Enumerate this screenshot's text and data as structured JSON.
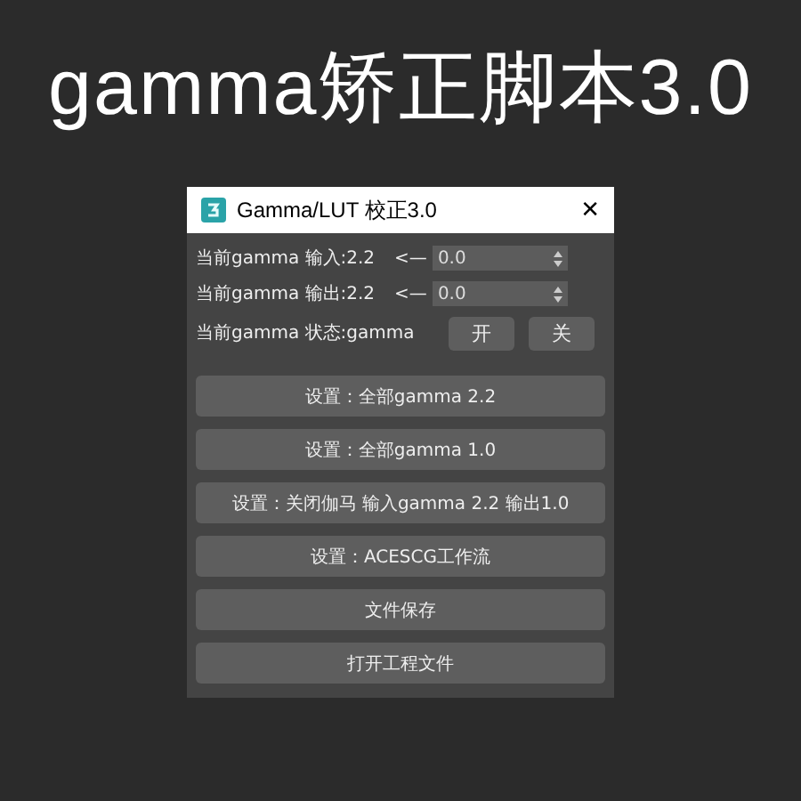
{
  "heading": "gamma矫正脚本3.0",
  "window": {
    "title": "Gamma/LUT 校正3.0",
    "close": "✕"
  },
  "rows": [
    {
      "kind": "spinner",
      "label": "当前gamma 输入:2.2",
      "arrow": "<—",
      "value": "0.0"
    },
    {
      "kind": "spinner",
      "label": "当前gamma 输出:2.2",
      "arrow": "<—",
      "value": "0.0"
    },
    {
      "kind": "toggles",
      "label": "当前gamma 状态:gamma",
      "buttons": [
        "开",
        "关"
      ]
    }
  ],
  "buttons": [
    "设置：全部gamma 2.2",
    "设置：全部gamma 1.0",
    "设置：关闭伽马 输入gamma 2.2 输出1.0",
    "设置：ACESCG工作流",
    "文件保存",
    "打开工程文件"
  ]
}
